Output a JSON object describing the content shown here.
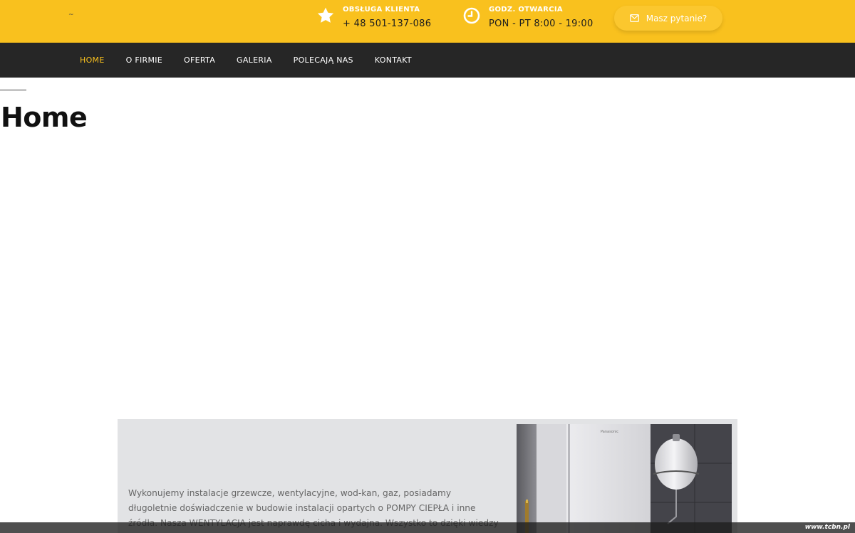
{
  "header": {
    "logo_text": "~",
    "customer_service": {
      "label": "OBSŁUGA KLIENTA",
      "value": "+ 48 501-137-086",
      "icon": "star-icon"
    },
    "opening_hours": {
      "label": "GODZ. OTWARCIA",
      "value": "PON - PT 8:00 - 19:00",
      "icon": "clock-icon"
    },
    "ask_button": {
      "label": "Masz pytanie?",
      "icon": "envelope-icon"
    }
  },
  "nav": {
    "items": [
      {
        "label": "HOME",
        "active": true
      },
      {
        "label": "O FIRMIE",
        "active": false
      },
      {
        "label": "OFERTA",
        "active": false
      },
      {
        "label": "GALERIA",
        "active": false
      },
      {
        "label": "POLECAJĄ NAS",
        "active": false
      },
      {
        "label": "KONTAKT",
        "active": false
      }
    ]
  },
  "page": {
    "title": "Home"
  },
  "content": {
    "paragraph": "Wykonujemy instalacje grzewcze, wentylacyjne, wod-kan, gaz, posiadamy długoletnie doświadczenie w budowie instalacji opartych o POMPY CIEPŁA i inne źródła. Nasza WENTYLACJA jest naprawdę cicha i wydajna. Wszystko to dzięki wiedzy jaką posiadamy."
  },
  "footer": {
    "credit": "www.tcbn.pl"
  },
  "colors": {
    "brand_yellow": "#f9c11e",
    "nav_dark": "#262626",
    "content_gray": "#e2e3e5"
  }
}
